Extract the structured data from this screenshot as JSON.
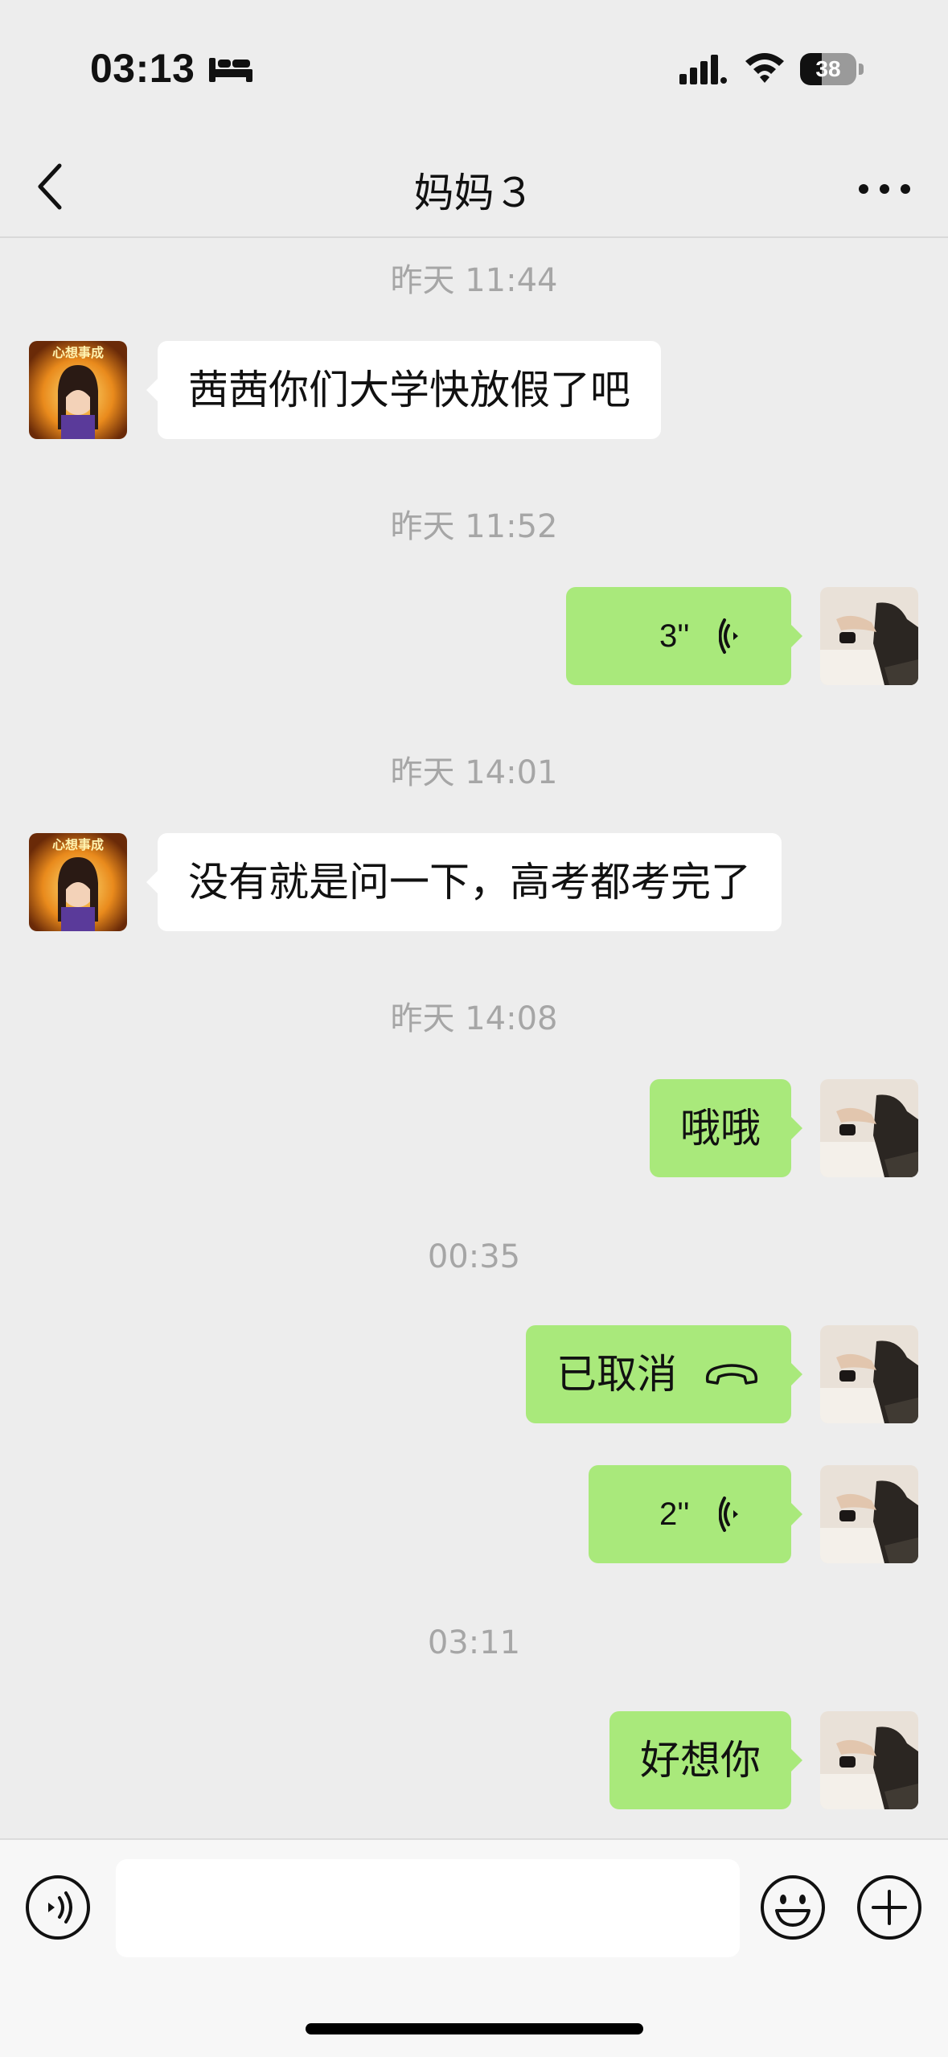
{
  "status_bar": {
    "time": "03:13",
    "battery_level": "38",
    "battery_fraction": 0.38,
    "icons": [
      "bed-icon",
      "cellular-signal-icon",
      "wifi-icon",
      "battery-icon"
    ]
  },
  "header": {
    "title": "妈妈３",
    "back_icon": "chevron-left-icon",
    "more_icon": "ellipsis-icon"
  },
  "messages": [
    {
      "kind": "timestamp",
      "text": "昨天 11:44"
    },
    {
      "kind": "text",
      "side": "in",
      "text": "茜茜你们大学快放假了吧"
    },
    {
      "kind": "timestamp",
      "text": "昨天 11:52"
    },
    {
      "kind": "voice",
      "side": "out",
      "duration": "3''"
    },
    {
      "kind": "timestamp",
      "text": "昨天 14:01"
    },
    {
      "kind": "text",
      "side": "in",
      "text": "没有就是问一下，高考都考完了"
    },
    {
      "kind": "timestamp",
      "text": "昨天 14:08"
    },
    {
      "kind": "text",
      "side": "out",
      "text": "哦哦"
    },
    {
      "kind": "timestamp",
      "text": "00:35"
    },
    {
      "kind": "call",
      "side": "out",
      "text": "已取消"
    },
    {
      "kind": "voice",
      "side": "out",
      "duration": "2''"
    },
    {
      "kind": "timestamp",
      "text": "03:11"
    },
    {
      "kind": "text",
      "side": "out",
      "text": "好想你"
    }
  ],
  "contact_avatar": {
    "caption": "心想事成"
  },
  "input_bar": {
    "placeholder": "",
    "icons": [
      "voice-mode-icon",
      "emoji-icon",
      "plus-icon"
    ]
  },
  "colors": {
    "background": "#ededed",
    "outgoing_bubble": "#a9e97b",
    "incoming_bubble": "#ffffff",
    "timestamp_text": "#a6a6a6"
  }
}
